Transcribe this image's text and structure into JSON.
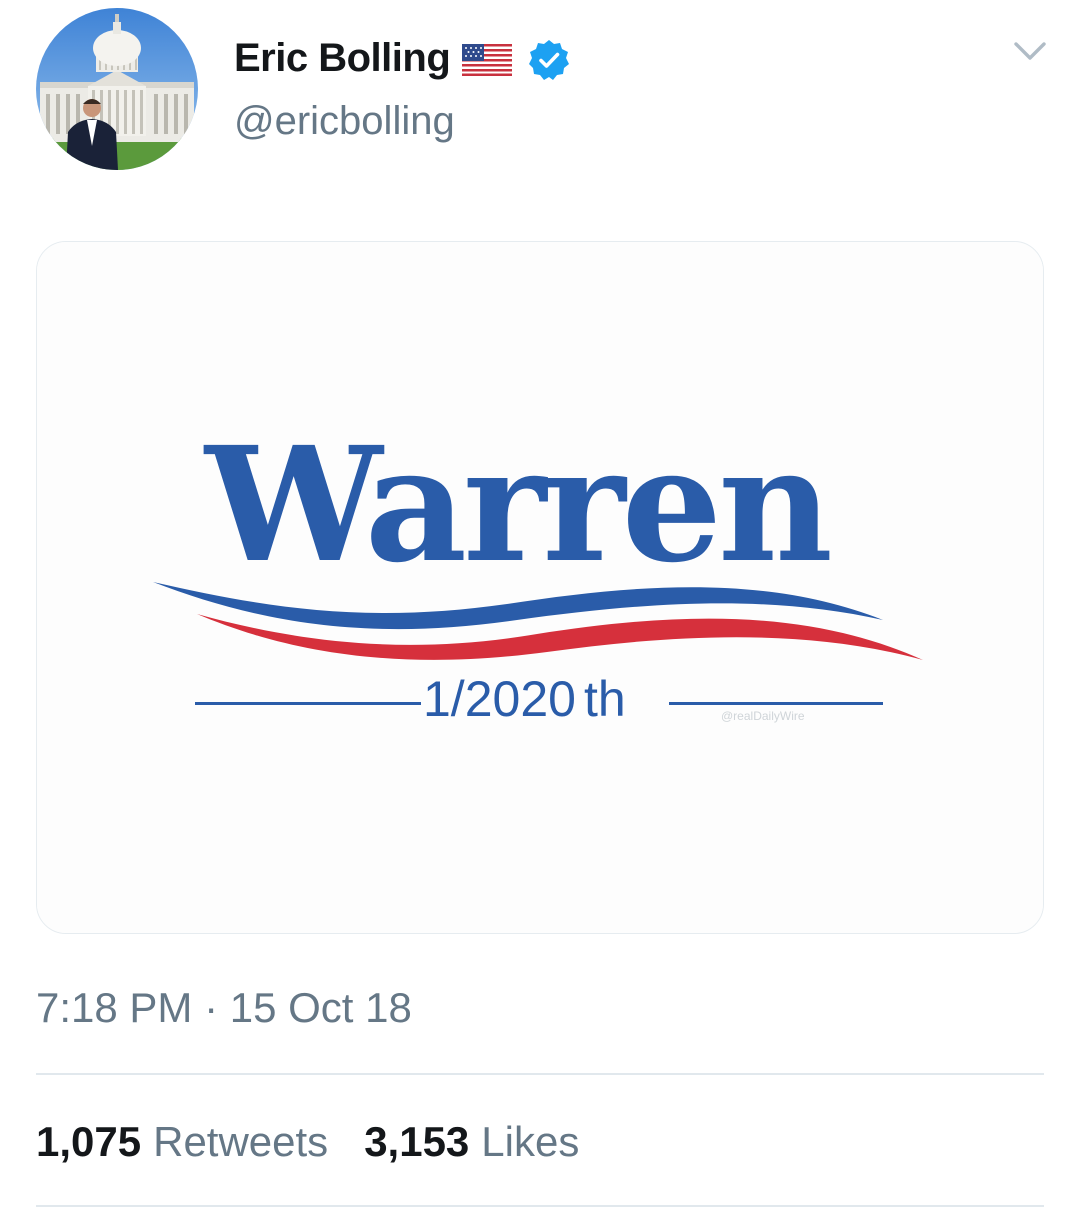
{
  "tweet": {
    "author": {
      "display_name": "Eric Bolling",
      "handle": "@ericbolling",
      "avatar_icon": "capitol-building-portrait",
      "flag_icon": "us-flag-icon",
      "verified_icon": "verified-badge-icon"
    },
    "menu_icon": "chevron-down-icon",
    "media": {
      "headline": "Warren",
      "subline": "1/2020th",
      "subline_number": "1/2020",
      "subline_suffix": "th",
      "watermark": "@realDailyWire",
      "colors": {
        "blue": "#2a5ca9",
        "red": "#d6303c"
      }
    },
    "timestamp": "7:18 PM · 15 Oct 18",
    "stats": {
      "retweets_count": "1,075",
      "retweets_label": "Retweets",
      "likes_count": "3,153",
      "likes_label": "Likes"
    }
  },
  "colors": {
    "verified_blue": "#1da1f2",
    "secondary_text": "#657786",
    "primary_text": "#14171a",
    "divider": "#e1e8ed"
  }
}
